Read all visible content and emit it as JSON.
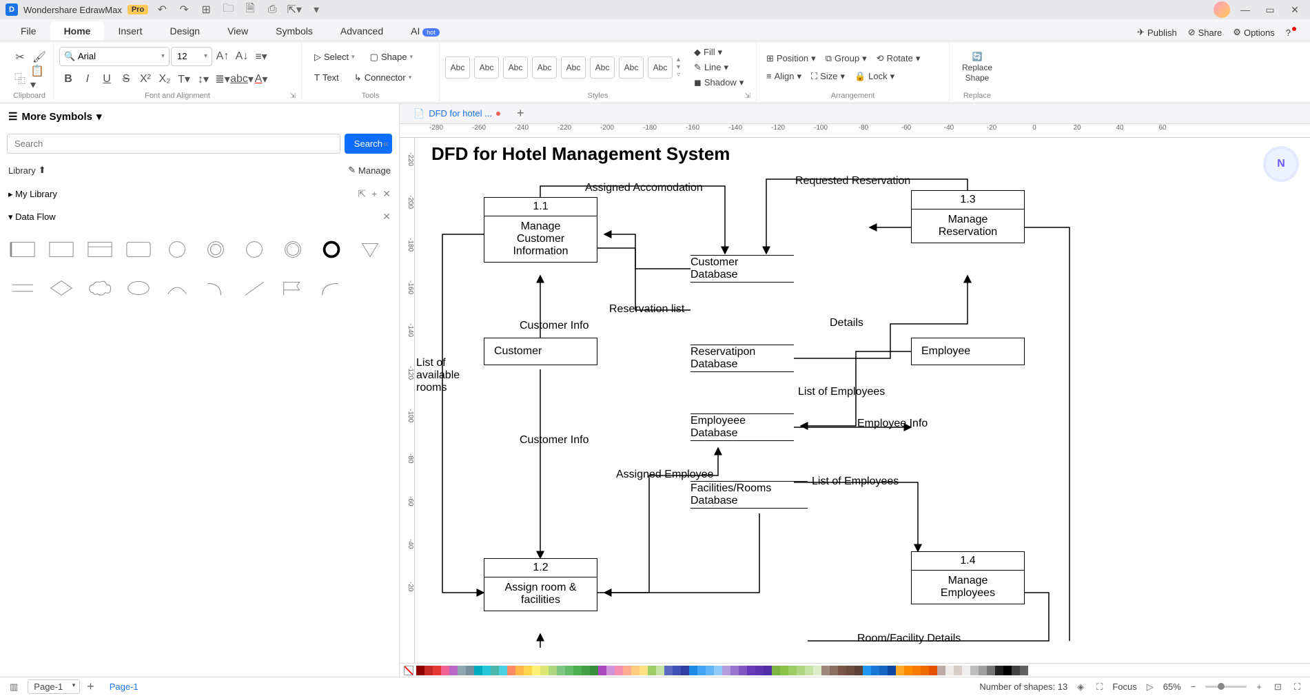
{
  "app": {
    "name": "Wondershare EdrawMax",
    "badge": "Pro"
  },
  "menu": {
    "tabs": [
      "File",
      "Home",
      "Insert",
      "Design",
      "View",
      "Symbols",
      "Advanced",
      "AI"
    ],
    "active": 1,
    "hot": "hot",
    "right": [
      "Publish",
      "Share",
      "Options"
    ]
  },
  "ribbon": {
    "font": {
      "name": "Arial",
      "size": "12"
    },
    "tools": {
      "select": "Select",
      "shape": "Shape",
      "text": "Text",
      "connector": "Connector"
    },
    "abc": "Abc",
    "style": {
      "fill": "Fill",
      "line": "Line",
      "shadow": "Shadow"
    },
    "arrange": {
      "position": "Position",
      "group": "Group",
      "rotate": "Rotate",
      "align": "Align",
      "size": "Size",
      "lock": "Lock"
    },
    "replace": "Replace\nShape",
    "groups": {
      "clipboard": "Clipboard",
      "font": "Font and Alignment",
      "tools": "Tools",
      "styles": "Styles",
      "arrange": "Arrangement",
      "replace": "Replace"
    }
  },
  "left": {
    "title": "More Symbols",
    "search_ph": "Search",
    "search_btn": "Search",
    "library": "Library",
    "manage": "Manage",
    "mylib": "My Library",
    "category": "Data Flow"
  },
  "doc": {
    "tab": "DFD for hotel ..."
  },
  "hruler": [
    "-280",
    "-260",
    "-240",
    "-220",
    "-200",
    "-180",
    "-160",
    "-140",
    "-120",
    "-100",
    "-80",
    "-60",
    "-40",
    "-20",
    "0",
    "20",
    "40",
    "60"
  ],
  "vruler": [
    "-220",
    "-200",
    "-180",
    "-160",
    "-140",
    "-120",
    "-100",
    "-80",
    "-60",
    "-40",
    "-20"
  ],
  "diagram": {
    "title": "DFD for Hotel Management System",
    "p11_num": "1.1",
    "p11": "Manage\nCustomer\nInformation",
    "p12_num": "1.2",
    "p12": "Assign room &\nfacilities",
    "p13_num": "1.3",
    "p13": "Manage\nReservation",
    "p14_num": "1.4",
    "p14": "Manage\nEmployees",
    "customer": "Customer",
    "employee": "Employee",
    "ds_cust": "Customer\nDatabase",
    "ds_res": "Reservatipon\nDatabase",
    "ds_emp": "Employeee\nDatabase",
    "ds_fac": "Facilities/Rooms\nDatabase",
    "l_assigned_acc": "Assigned Accomodation",
    "l_req_res": "Requested Reservation",
    "l_res_list": "Reservation list",
    "l_details": "Details",
    "l_cust_info1": "Customer Info",
    "l_cust_info2": "Customer Info",
    "l_avail": "List of\navailable\nrooms",
    "l_emp_list1": "List of Employees",
    "l_emp_list2": "List of Employees",
    "l_emp_info": "Employee Info",
    "l_assigned_emp": "Assigned Employee",
    "l_room_det": "Room/Facility Details"
  },
  "status": {
    "page_sel": "Page-1",
    "page_tab": "Page-1",
    "shapes": "Number of shapes: 13",
    "focus": "Focus",
    "zoom": "65%"
  },
  "colors": [
    "#8b0000",
    "#c62828",
    "#e53935",
    "#f06292",
    "#ba68c8",
    "#90a4ae",
    "#78909c",
    "#00acc1",
    "#26c6da",
    "#4db6ac",
    "#4dd0e1",
    "#ff8a65",
    "#ffb74d",
    "#ffd54f",
    "#fff176",
    "#dce775",
    "#aed581",
    "#81c784",
    "#66bb6a",
    "#4caf50",
    "#43a047",
    "#388e3c",
    "#ab47bc",
    "#ce93d8",
    "#f48fb1",
    "#ffab91",
    "#ffcc80",
    "#ffe082",
    "#9ccc65",
    "#c5e1a5",
    "#5c6bc0",
    "#3f51b5",
    "#303f9f",
    "#1e88e5",
    "#42a5f5",
    "#64b5f6",
    "#90caf9",
    "#b39ddb",
    "#9575cd",
    "#7e57c2",
    "#673ab7",
    "#5e35b1",
    "#512da8",
    "#7cb342",
    "#8bc34a",
    "#9ccc65",
    "#aed581",
    "#c5e1a5",
    "#dcedc8",
    "#a1887f",
    "#8d6e63",
    "#795548",
    "#6d4c41",
    "#5d4037",
    "#2196f3",
    "#1976d2",
    "#1565c0",
    "#0d47a1",
    "#ffa726",
    "#fb8c00",
    "#f57c00",
    "#ef6c00",
    "#e65100",
    "#bcaaa4",
    "#efebe9",
    "#d7ccc8",
    "#eeeeee",
    "#bdbdbd",
    "#9e9e9e",
    "#757575",
    "#212121",
    "#000000",
    "#424242",
    "#616161"
  ]
}
